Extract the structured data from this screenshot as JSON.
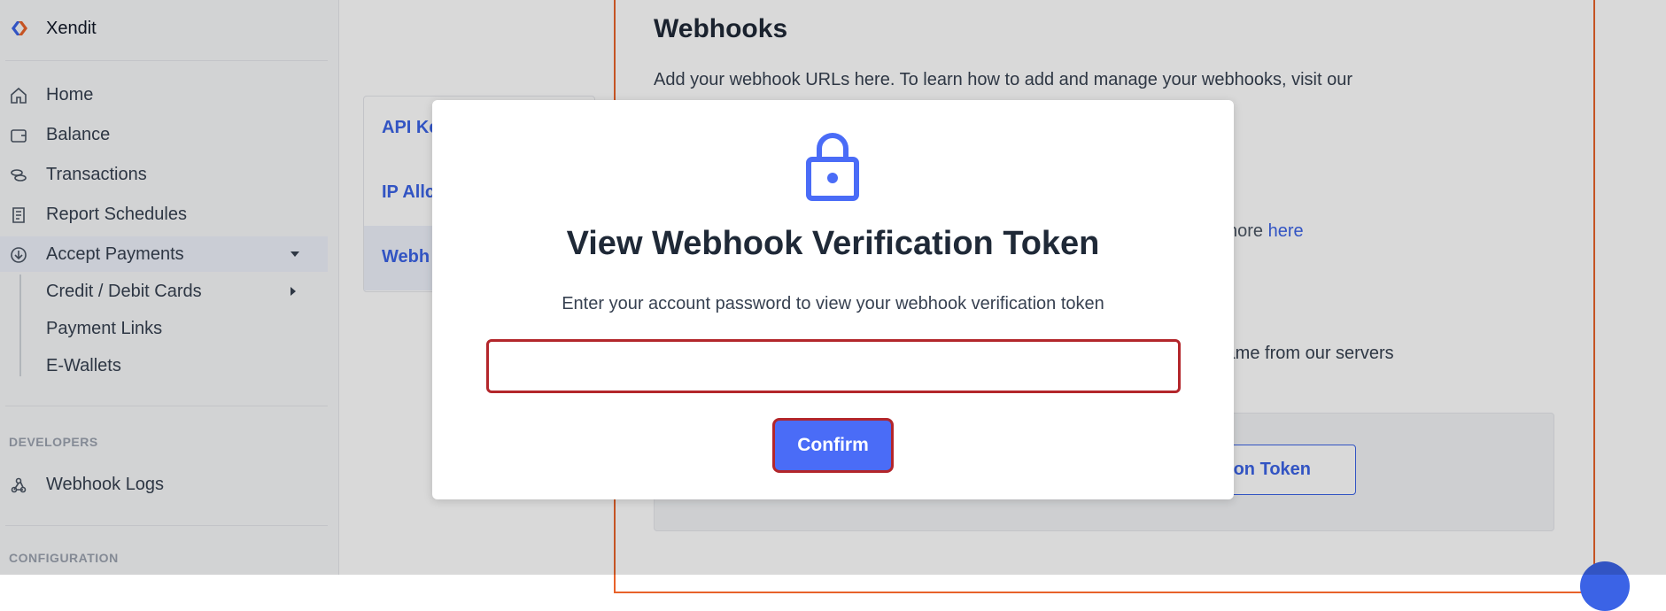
{
  "brand": {
    "name": "Xendit"
  },
  "sidebar": {
    "items": [
      {
        "label": "Home",
        "icon": "home-icon"
      },
      {
        "label": "Balance",
        "icon": "wallet-icon"
      },
      {
        "label": "Transactions",
        "icon": "coins-icon"
      },
      {
        "label": "Report Schedules",
        "icon": "scroll-icon"
      },
      {
        "label": "Accept Payments",
        "icon": "download-circle-icon"
      }
    ],
    "sub_items": [
      "Credit / Debit Cards",
      "Payment Links",
      "E-Wallets"
    ],
    "developers_label": "DEVELOPERS",
    "webhook_logs_label": "Webhook Logs",
    "configuration_label": "CONFIGURATION"
  },
  "settings_nav": {
    "items": [
      {
        "label": "API Ke"
      },
      {
        "label": "IP Allc"
      },
      {
        "label": "Webh"
      }
    ]
  },
  "panel": {
    "title": "Webhooks",
    "description": "Add your webhook URLs here. To learn how to add and manage your webhooks, visit our",
    "learn_more_prefix": "nore",
    "learn_more_link": "here",
    "servers_text": "k came from our servers",
    "token_button_label": "on Token"
  },
  "modal": {
    "title": "View Webhook Verification Token",
    "subtitle": "Enter your account password to view your webhook verification token",
    "password_value": "",
    "confirm_label": "Confirm"
  },
  "colors": {
    "accent": "#4a6cf7",
    "link": "#3b63e6",
    "panel_border": "#e8622a",
    "highlight_border": "#b3262b"
  }
}
